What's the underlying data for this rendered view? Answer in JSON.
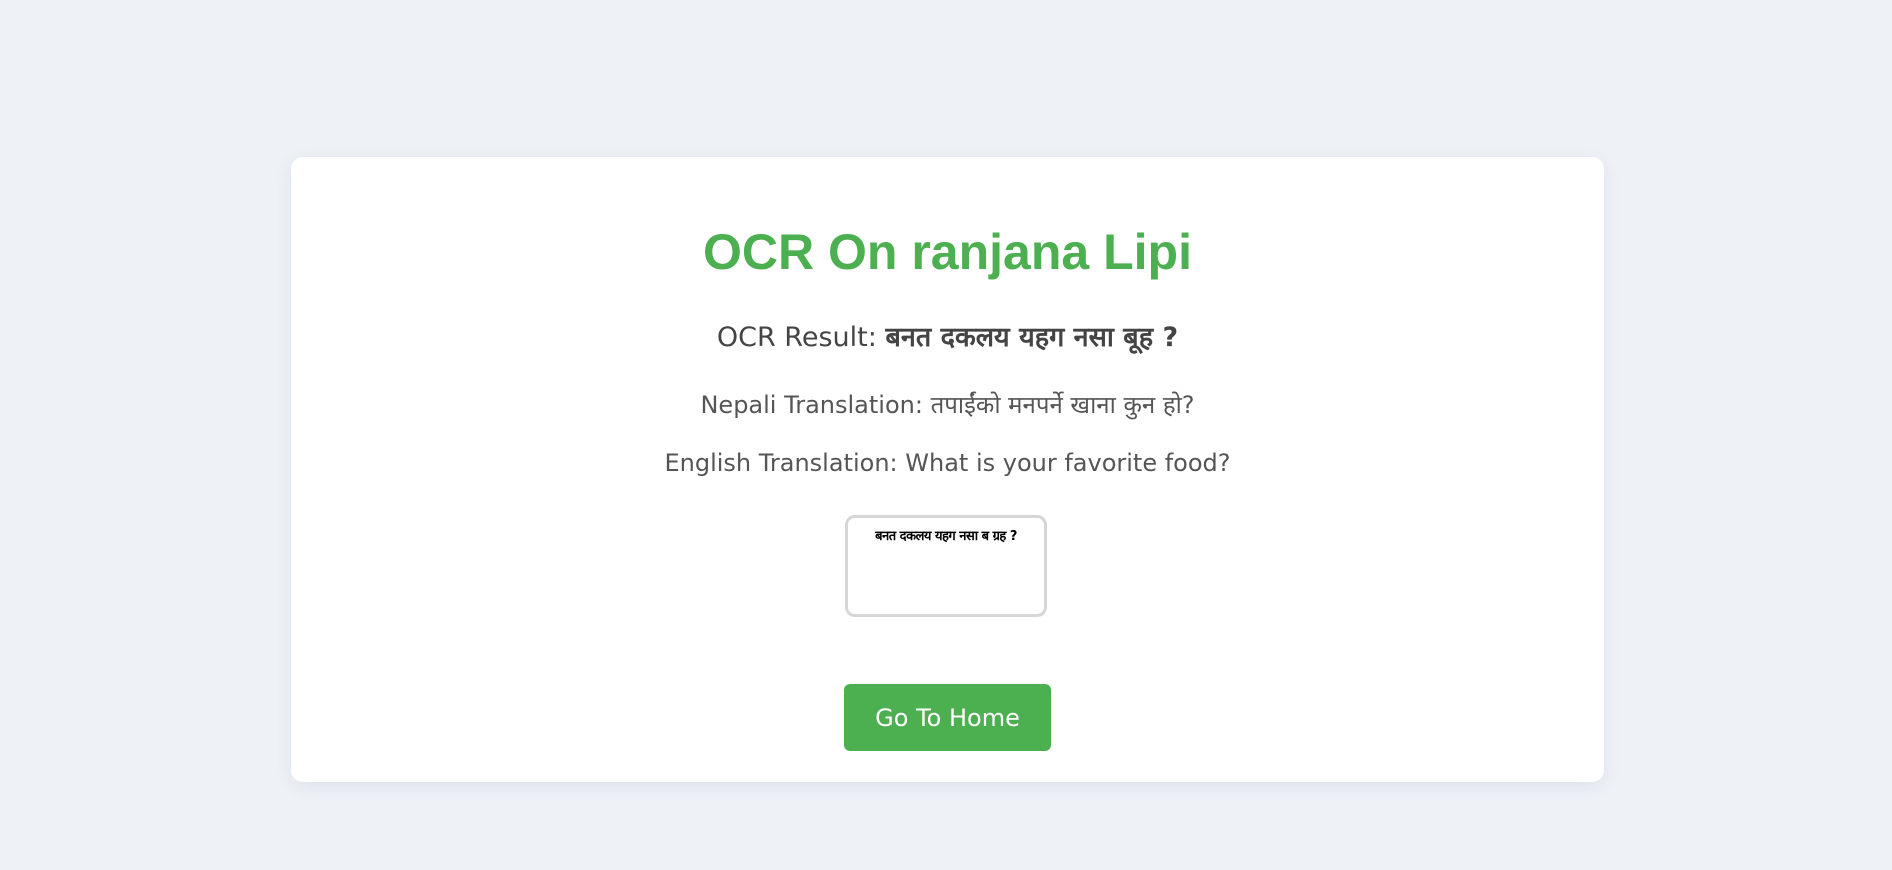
{
  "page": {
    "title": "OCR On ranjana Lipi"
  },
  "ocr_result": {
    "label": "OCR Result:",
    "value": "बनत दकलय यहग नसा बूह ?"
  },
  "nepali_translation": {
    "label": "Nepali Translation:",
    "value": "तपाईंको मनपर्ने खाना कुन हो?"
  },
  "english_translation": {
    "label": "English Translation:",
    "value": "What is your favorite food?"
  },
  "uploaded_image": {
    "text": "बनत दकलय यहग नसा ब ग्रह ?"
  },
  "actions": {
    "home_label": "Go To Home"
  },
  "colors": {
    "accent": "#4caf50",
    "background": "#eef2f7",
    "card": "#ffffff",
    "text": "#555555"
  }
}
